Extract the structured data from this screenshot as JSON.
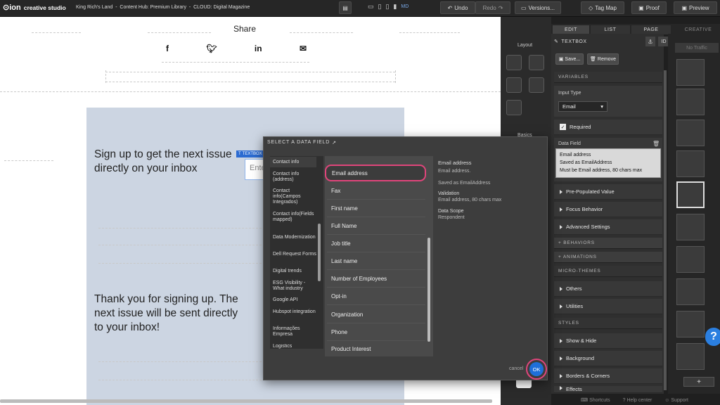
{
  "topbar": {
    "brand": "creative studio",
    "breadcrumb": "King Rich's Land  -  Content Hub: Premium Library  -  CLOUD: Digital Magazine",
    "device_label": "MD",
    "undo": "Undo",
    "redo": "Redo",
    "versions": "Versions...",
    "tagmap": "Tag Map",
    "proof": "Proof",
    "preview": "Preview"
  },
  "canvas": {
    "share_title": "Share",
    "signup_text": "Sign up to get the next issue directly on your inbox",
    "textbox_badge": "TEXTBOX",
    "input_placeholder": "Ente",
    "thanks_text": "Thank you for signing up. The next issue will be sent directly to your inbox!"
  },
  "left_tools": {
    "layout_label": "Layout",
    "basics_label": "Basics"
  },
  "panel": {
    "tabs": [
      "EDIT",
      "LIST",
      "PAGE"
    ],
    "creative_tab": "CREATIVE",
    "element_label": "TEXTBOX",
    "id_label": "ID",
    "save": "Save...",
    "remove": "Remove",
    "variables": "VARIABLES",
    "input_type_label": "Input Type",
    "input_type_value": "Email",
    "required": "Required",
    "data_field_label": "Data Field",
    "data_field_lines": [
      "Email address",
      "Saved as EmailAddress",
      "Must be Email address, 80 chars max"
    ],
    "collapsibles": [
      "Pre-Populated Value",
      "Focus Behavior",
      "Advanced Settings"
    ],
    "behaviors": "+ BEHAVIORS",
    "animations": "+ ANIMATIONS",
    "micro_themes": "MICRO-THEMES",
    "micro_items": [
      "Others",
      "Utilities"
    ],
    "styles": "STYLES",
    "style_items": [
      "Show & Hide",
      "Background",
      "Borders & Corners",
      "Effects"
    ]
  },
  "thumbs": {
    "no_traffic": "No Traffic",
    "add": "+"
  },
  "footer": {
    "shortcuts": "Shortcuts",
    "help": "Help center",
    "support": "Support"
  },
  "help_badge": "?",
  "modal": {
    "title": "SELECT A DATA FIELD",
    "categories": [
      "Contact info",
      "Contact info (address)",
      "Contact info(Campos Integrados)",
      "Contact info(Fields mapped)",
      "Data Modernization",
      "Dell Request Forms",
      "Digital trends",
      "ESG Visibility - What industry",
      "Google API",
      "Hubspot integration",
      "Informações Empresa",
      "Logistics"
    ],
    "fields": [
      "Email address",
      "Fax",
      "First name",
      "Full Name",
      "Job title",
      "Last name",
      "Number of Employees",
      "Opt-in",
      "Organization",
      "Phone",
      "Product Interest"
    ],
    "detail": {
      "name": "Email address",
      "desc": "Email address.",
      "saved": "Saved as EmailAddress",
      "validation_label": "Validation",
      "validation": "Email address, 80 chars max",
      "scope_label": "Data Scope",
      "scope": "Respondent"
    },
    "cancel": "cancel",
    "ok": "OK"
  },
  "colors": {
    "accent": "#e0457b",
    "ok_blue": "#1e6fd9",
    "canvas_block": "#ccd5e2"
  }
}
